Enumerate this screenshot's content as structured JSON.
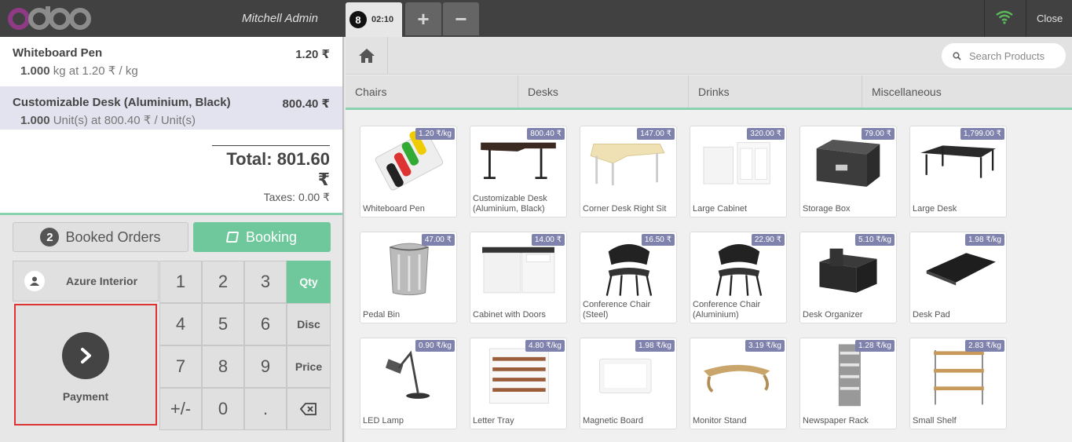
{
  "header": {
    "logo": "odoo",
    "user": "Mitchell Admin",
    "order_badge": "8",
    "order_time": "02:10",
    "add_label": "+",
    "remove_label": "−",
    "close_label": "Close",
    "wifi_color": "#5cb85c"
  },
  "order": {
    "lines": [
      {
        "name": "Whiteboard Pen",
        "price": "1.20 ₹",
        "qty": "1.000",
        "info": "kg at 1.20 ₹ / kg"
      },
      {
        "name": "Customizable Desk (Aluminium, Black)",
        "price": "800.40 ₹",
        "qty": "1.000",
        "info": "Unit(s) at 800.40 ₹ / Unit(s)"
      }
    ],
    "total": "Total: 801.60 ₹",
    "taxes": "Taxes: 0.00 ₹"
  },
  "controls": {
    "booked_count": "2",
    "booked_label": "Booked Orders",
    "booking_label": "Booking",
    "customer": "Azure Interior",
    "payment_label": "Payment"
  },
  "numpad": {
    "keys": [
      "1",
      "2",
      "3",
      "Qty",
      "4",
      "5",
      "6",
      "Disc",
      "7",
      "8",
      "9",
      "Price",
      "+/-",
      "0",
      "."
    ],
    "active": "Qty"
  },
  "search": {
    "placeholder": "Search Products"
  },
  "categories": [
    "Chairs",
    "Desks",
    "Drinks",
    "Miscellaneous"
  ],
  "products": [
    {
      "name": "Whiteboard Pen",
      "price": "1.20 ₹/kg",
      "art": "pens"
    },
    {
      "name": "Customizable Desk (Aluminium, Black)",
      "price": "800.40 ₹",
      "art": "desk"
    },
    {
      "name": "Corner Desk Right Sit",
      "price": "147.00 ₹",
      "art": "corner"
    },
    {
      "name": "Large Cabinet",
      "price": "320.00 ₹",
      "art": "cabinet"
    },
    {
      "name": "Storage Box",
      "price": "79.00 ₹",
      "art": "box"
    },
    {
      "name": "Large Desk",
      "price": "1,799.00 ₹",
      "art": "largedesk"
    },
    {
      "name": "Pedal Bin",
      "price": "47.00 ₹",
      "art": "bin"
    },
    {
      "name": "Cabinet with Doors",
      "price": "14.00 ₹",
      "art": "doors"
    },
    {
      "name": "Conference Chair (Steel)",
      "price": "16.50 ₹",
      "art": "chair"
    },
    {
      "name": "Conference Chair (Aluminium)",
      "price": "22.90 ₹",
      "art": "chair"
    },
    {
      "name": "Desk Organizer",
      "price": "5.10 ₹/kg",
      "art": "organizer"
    },
    {
      "name": "Desk Pad",
      "price": "1.98 ₹/kg",
      "art": "pad"
    },
    {
      "name": "LED Lamp",
      "price": "0.90 ₹/kg",
      "art": "lamp"
    },
    {
      "name": "Letter Tray",
      "price": "4.80 ₹/kg",
      "art": "tray"
    },
    {
      "name": "Magnetic Board",
      "price": "1.98 ₹/kg",
      "art": "board"
    },
    {
      "name": "Monitor Stand",
      "price": "3.19 ₹/kg",
      "art": "stand"
    },
    {
      "name": "Newspaper Rack",
      "price": "1.28 ₹/kg",
      "art": "rack"
    },
    {
      "name": "Small Shelf",
      "price": "2.83 ₹/kg",
      "art": "shelf"
    }
  ]
}
